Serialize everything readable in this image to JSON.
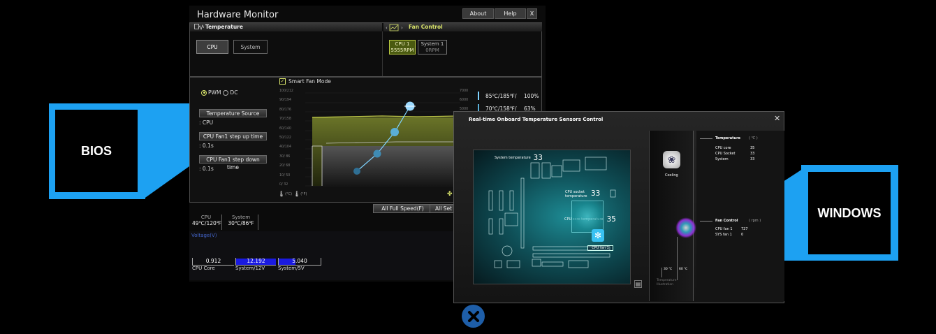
{
  "bios_label": "BIOS",
  "windows_label": "WINDOWS",
  "hardware_monitor": {
    "title": "Hardware Monitor",
    "buttons": {
      "about": "About",
      "help": "Help",
      "close": "X"
    },
    "temperature": {
      "header": "Temperature",
      "tabs": [
        "CPU",
        "System"
      ]
    },
    "fan_control": {
      "header": "Fan Control",
      "fans": [
        {
          "name": "CPU 1",
          "speed": "5555RPM"
        },
        {
          "name": "System 1",
          "speed": "0RPM"
        }
      ]
    },
    "mode": {
      "pwm": "PWM",
      "dc": "DC",
      "selected": "PWM"
    },
    "smart_fan_mode": "Smart Fan Mode",
    "temperature_source": {
      "label": "Temperature Source",
      "value": ": CPU"
    },
    "step_up": {
      "label": "CPU Fan1 step up time",
      "value": ": 0.1s"
    },
    "step_down": {
      "label": "CPU Fan1 step down time",
      "value": ": 0.1s"
    },
    "y_left": [
      "100/212",
      "90/194",
      "80/176",
      "70/158",
      "60/140",
      "50/122",
      "40/104",
      "30/ 86",
      "20/ 68",
      "10/ 50",
      "0/ 32"
    ],
    "y_right": [
      "7000",
      "6000",
      "5000"
    ],
    "unit_c": "(°C)",
    "unit_f": "(°F)",
    "legend": [
      {
        "temp": "85℃/185℉/",
        "pct": "100%"
      },
      {
        "temp": "70℃/158℉/",
        "pct": "63%"
      }
    ],
    "actions": {
      "full_speed": "All Full Speed(F)",
      "set": "All Set"
    },
    "readouts": [
      {
        "name": "CPU",
        "value": "49℃/120℉"
      },
      {
        "name": "System",
        "value": "30℃/86℉"
      }
    ],
    "voltage_header": "Voltage(V)",
    "voltages": [
      {
        "value": "0.912",
        "name": "CPU Core",
        "fill": 0.0
      },
      {
        "value": "12.192",
        "name": "System/12V",
        "fill": 1.0
      },
      {
        "value": "5.040",
        "name": "System/5V",
        "fill": 0.4
      }
    ]
  },
  "sensors_dialog": {
    "title": "Real-time Onboard Temperature Sensors Control",
    "close": "✕",
    "board": {
      "system_temp_label": "System temperature",
      "system_temp": "33",
      "socket_label_1": "CPU socket",
      "socket_label_2": "temperature",
      "socket_temp": "33",
      "core_label": "CPU core temperature",
      "core_temp": "35",
      "fan_badge": "CPU fan 1"
    },
    "cooling_label": "Cooling",
    "illustration": {
      "low": "30 ℃",
      "high": "60 ℃",
      "caption_1": "Temperature",
      "caption_2": "Illustration"
    },
    "temperature": {
      "header": "Temperature",
      "unit": "( ℃ )",
      "rows": [
        {
          "name": "CPU core",
          "value": "35"
        },
        {
          "name": "CPU Socket",
          "value": "33"
        },
        {
          "name": "System",
          "value": "33"
        }
      ]
    },
    "fan_control": {
      "header": "Fan Control",
      "unit": "( rpm )",
      "rows": [
        {
          "name": "CPU fan 1",
          "value": "727"
        },
        {
          "name": "SYS fan 1",
          "value": "0"
        }
      ]
    }
  },
  "colors": {
    "accent_blue": "#1da1f2",
    "fan_active": "#4a5a10",
    "curve": "#7fd3ff",
    "olive_fill": "#5a6520"
  },
  "close_overlay_icon": "close-circle-icon"
}
